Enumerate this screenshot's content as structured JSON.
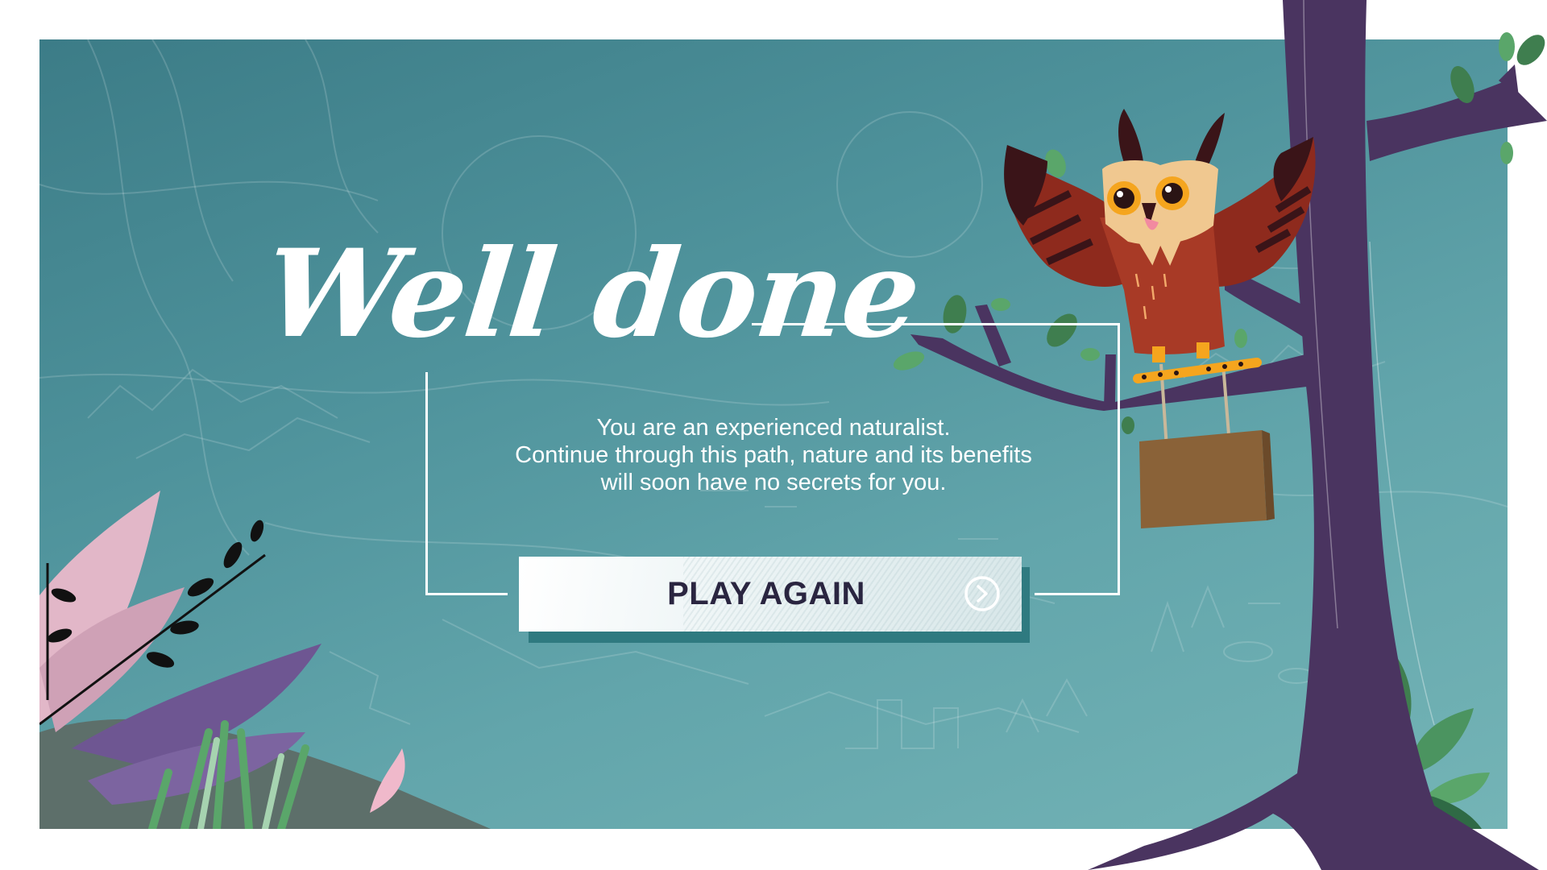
{
  "end_screen": {
    "title": "Well done",
    "message_lines": [
      "You are an experienced naturalist.",
      "Continue through this path, nature and its benefits",
      "will soon have no secrets for you."
    ],
    "play_again_label": "PLAY AGAIN"
  },
  "icons": {
    "play_again_icon": "arrow-right-circle-icon",
    "mascot": "owl-illustration"
  },
  "colors": {
    "background_teal": "#4e929b",
    "tree_purple": "#4a3460",
    "owl_body": "#a83a26",
    "button_text": "#2a2540",
    "button_shadow": "#2f7a80"
  }
}
